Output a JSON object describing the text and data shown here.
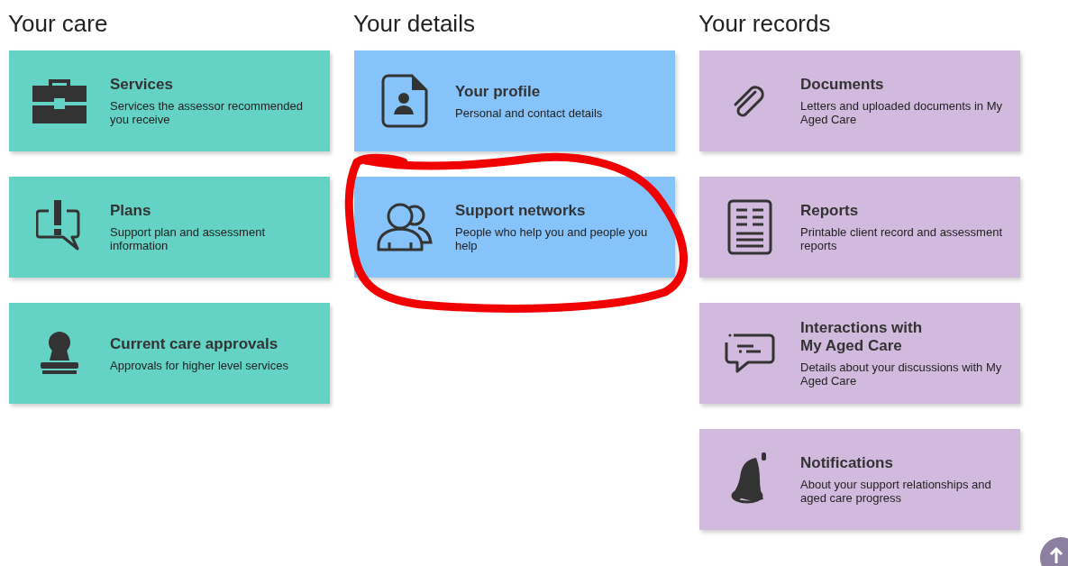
{
  "columns": [
    {
      "heading": "Your care",
      "color": "#64d2c4",
      "cards": [
        {
          "title": "Services",
          "description": "Services the assessor recommended you receive"
        },
        {
          "title": "Plans",
          "description": "Support plan and assessment information"
        },
        {
          "title": "Current care approvals",
          "description": "Approvals for higher level services"
        }
      ]
    },
    {
      "heading": "Your details",
      "color": "#85c3fa",
      "cards": [
        {
          "title": "Your profile",
          "description": "Personal and contact details"
        },
        {
          "title": "Support networks",
          "description": "People who help you and people you help"
        }
      ]
    },
    {
      "heading": "Your records",
      "color": "#d2bade",
      "cards": [
        {
          "title": "Documents",
          "description": "Letters and uploaded documents in My Aged Care"
        },
        {
          "title": "Reports",
          "description": "Printable client record and assessment reports"
        },
        {
          "title": "Interactions with\nMy Aged Care",
          "description": "Details about your discussions with My Aged Care"
        },
        {
          "title": "Notifications",
          "description": "About your support relationships and aged care progress"
        }
      ]
    }
  ]
}
